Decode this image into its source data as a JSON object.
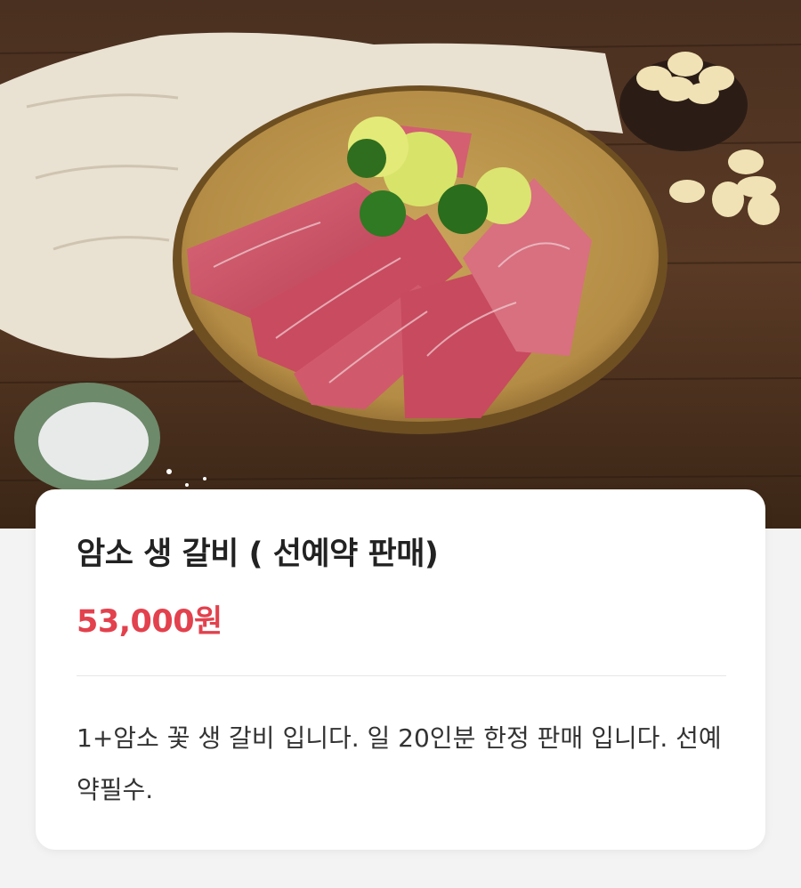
{
  "product": {
    "image_alt": "Marbled raw beef galbi on a ceramic plate with lime, parsley, garlic and salt",
    "title": "암소 생 갈비 ( 선예약 판매)",
    "price": "53,000원",
    "description": "1+암소 꽃 생 갈비 입니다. 일 20인분 한정 판매 입니다. 선예약필수."
  },
  "colors": {
    "price": "#e2414d",
    "title": "#222222",
    "background": "#f3f3f3"
  }
}
